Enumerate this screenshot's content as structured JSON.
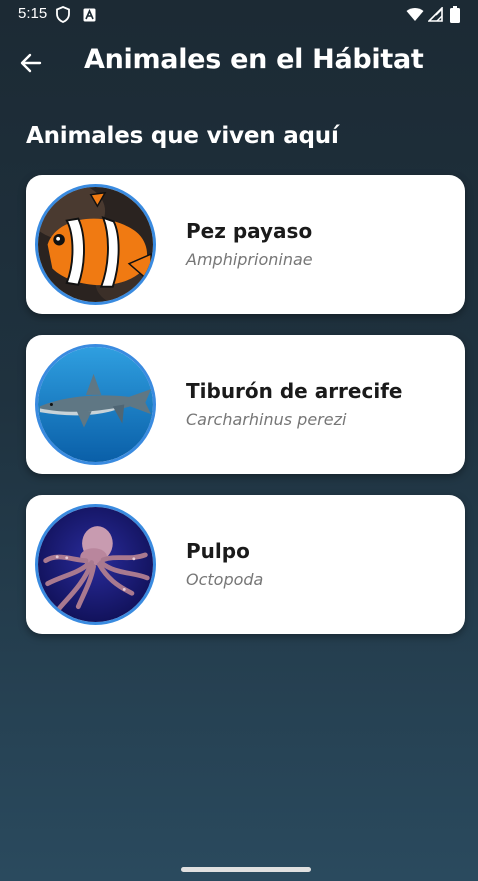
{
  "status_bar": {
    "time": "5:15",
    "icons": [
      "shield-icon",
      "a-notification-icon",
      "wifi-icon",
      "signal-icon",
      "battery-icon"
    ]
  },
  "app_bar": {
    "back_icon": "arrow-left-icon",
    "title": "Animales en el Hábitat"
  },
  "section": {
    "title": "Animales que viven aquí"
  },
  "animals": [
    {
      "name": "Pez payaso",
      "scientific_name": "Amphiprioninae",
      "image": "clownfish-photo"
    },
    {
      "name": "Tiburón de arrecife",
      "scientific_name": "Carcharhinus perezi",
      "image": "reef-shark-photo"
    },
    {
      "name": "Pulpo",
      "scientific_name": "Octopoda",
      "image": "octopus-photo"
    }
  ],
  "colors": {
    "background_top": "#1c2a34",
    "background_bottom": "#2a4a5e",
    "card": "#ffffff",
    "avatar_border": "#3a8be0",
    "name_text": "#1a1a1a",
    "scientific_text": "#777777"
  }
}
